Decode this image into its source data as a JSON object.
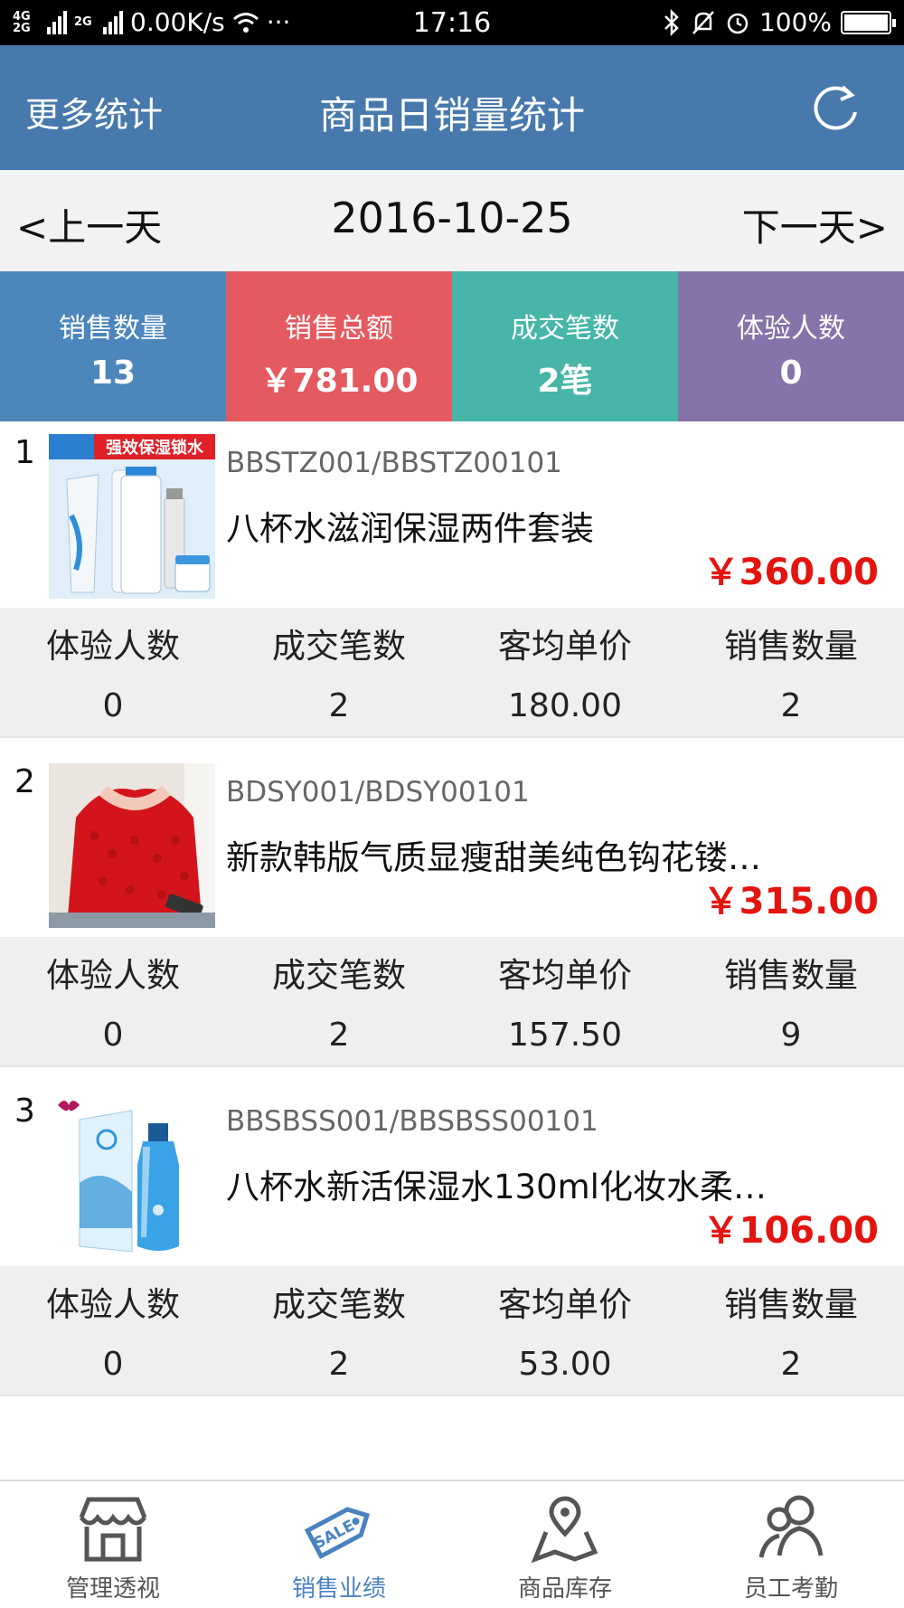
{
  "status_bar": {
    "network_top": "4G",
    "network_bottom": "2G",
    "network2": "2G",
    "speed": "0.00K/s",
    "more": "···",
    "time": "17:16",
    "battery": "100%"
  },
  "header": {
    "left_label": "更多统计",
    "title": "商品日销量统计",
    "refresh_icon": "refresh-icon"
  },
  "date_nav": {
    "prev": "<上一天",
    "date": "2016-10-25",
    "next": "下一天>"
  },
  "summary": [
    {
      "label": "销售数量",
      "value": "13",
      "color": "#4d86bb"
    },
    {
      "label": "销售总额",
      "value": "￥781.00",
      "color": "#e45a60"
    },
    {
      "label": "成交笔数",
      "value": "2笔",
      "color": "#47b5a8"
    },
    {
      "label": "体验人数",
      "value": "0",
      "color": "#8573a9"
    }
  ],
  "stat_labels": [
    "体验人数",
    "成交笔数",
    "客均单价",
    "销售数量"
  ],
  "products": [
    {
      "rank": "1",
      "sku": "BBSTZ001/BBSTZ00101",
      "name": "八杯水滋润保湿两件套装",
      "price": "￥360.00",
      "image_banner": "强效保湿锁水",
      "stats": [
        "0",
        "2",
        "180.00",
        "2"
      ]
    },
    {
      "rank": "2",
      "sku": "BDSY001/BDSY00101",
      "name": "新款韩版气质显瘦甜美纯色钩花镂…",
      "price": "￥315.00",
      "stats": [
        "0",
        "2",
        "157.50",
        "9"
      ]
    },
    {
      "rank": "3",
      "sku": "BBSBSS001/BBSBSS00101",
      "name": "八杯水新活保湿水130ml化妆水柔…",
      "price": "￥106.00",
      "stats": [
        "0",
        "2",
        "53.00",
        "2"
      ]
    }
  ],
  "tabs": [
    {
      "label": "管理透视",
      "icon": "store-icon",
      "active": false
    },
    {
      "label": "销售业绩",
      "icon": "sale-tag-icon",
      "active": true
    },
    {
      "label": "商品库存",
      "icon": "map-pin-icon",
      "active": false
    },
    {
      "label": "员工考勤",
      "icon": "people-icon",
      "active": false
    }
  ],
  "colors": {
    "header": "#4879ad",
    "price": "#e4140f",
    "active_tab": "#4a82c0"
  }
}
